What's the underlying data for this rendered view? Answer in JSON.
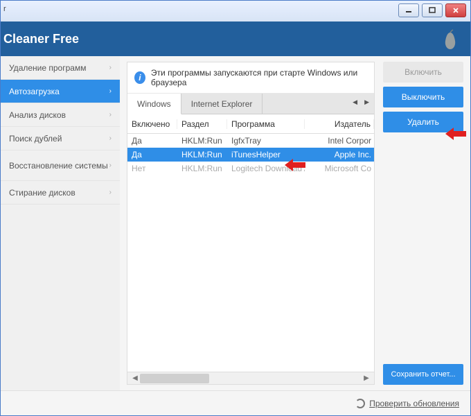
{
  "window": {
    "title_fragment": "r",
    "app_title": "Cleaner Free"
  },
  "sidebar": {
    "items": [
      {
        "label": "Удаление программ",
        "active": false
      },
      {
        "label": "Автозагрузка",
        "active": true
      },
      {
        "label": "Анализ дисков",
        "active": false
      },
      {
        "label": "Поиск дублей",
        "active": false
      },
      {
        "label": "Восстановление системы",
        "active": false,
        "tall": true
      },
      {
        "label": "Стирание дисков",
        "active": false
      }
    ]
  },
  "info": {
    "text": "Эти программы запускаются при старте Windows или браузера"
  },
  "tabs": {
    "items": [
      {
        "label": "Windows",
        "active": true
      },
      {
        "label": "Internet Explorer",
        "active": false
      }
    ]
  },
  "table": {
    "columns": {
      "enabled": "Включено",
      "section": "Раздел",
      "program": "Программа",
      "publisher": "Издатель"
    },
    "rows": [
      {
        "enabled": "Да",
        "section": "HKLM:Run",
        "program": "IgfxTray",
        "publisher": "Intel Corpor",
        "state": ""
      },
      {
        "enabled": "Да",
        "section": "HKLM:Run",
        "program": "iTunesHelper",
        "publisher": "Apple Inc.",
        "state": "selected"
      },
      {
        "enabled": "Нет",
        "section": "HKLM:Run",
        "program": "Logitech Download Assistant",
        "publisher": "Microsoft Co",
        "state": "disabled"
      }
    ]
  },
  "actions": {
    "enable": "Включить",
    "disable": "Выключить",
    "delete": "Удалить",
    "save_report": "Сохранить отчет..."
  },
  "status": {
    "check_updates": "Проверить обновления"
  }
}
